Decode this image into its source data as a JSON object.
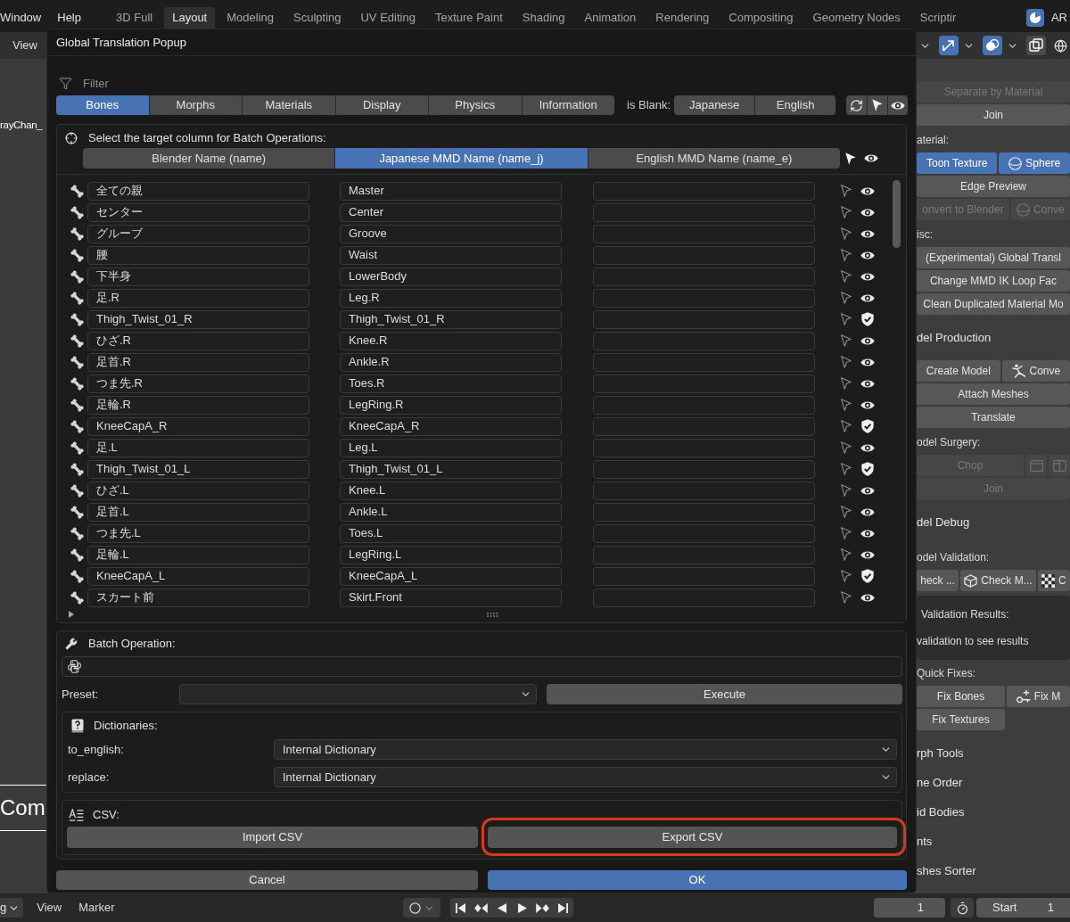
{
  "top_bar": {
    "menus": [
      "Window",
      "Help"
    ],
    "workspaces": [
      {
        "label": "3D Full",
        "selected": false
      },
      {
        "label": "Layout",
        "selected": true
      },
      {
        "label": "Modeling",
        "selected": false
      },
      {
        "label": "Sculpting",
        "selected": false
      },
      {
        "label": "UV Editing",
        "selected": false
      },
      {
        "label": "Texture Paint",
        "selected": false
      },
      {
        "label": "Shading",
        "selected": false
      },
      {
        "label": "Animation",
        "selected": false
      },
      {
        "label": "Rendering",
        "selected": false
      },
      {
        "label": "Compositing",
        "selected": false
      },
      {
        "label": "Geometry Nodes",
        "selected": false
      },
      {
        "label": "Scriptir",
        "selected": false
      }
    ],
    "scene_label": "AR"
  },
  "viewport_header": {
    "menu": "View",
    "toggles": [
      {
        "kind": "gizmo",
        "selected": true
      },
      {
        "kind": "overlay",
        "selected": true
      },
      {
        "kind": "xray",
        "selected": false
      }
    ]
  },
  "viewport": {
    "object_name": "rayChan_",
    "text_object": "Com"
  },
  "sidebar": {
    "panels": [
      {
        "items": [
          {
            "kind": "buttons",
            "buttons": [
              {
                "kind": "text",
                "label": "Separate by Material",
                "disabled": true,
                "selected": false
              }
            ]
          },
          {
            "kind": "buttons",
            "buttons": [
              {
                "kind": "text",
                "label": "Join",
                "disabled": false,
                "selected": false
              }
            ]
          },
          {
            "kind": "label",
            "text": "aterial:"
          },
          {
            "kind": "buttons",
            "buttons": [
              {
                "kind": "text",
                "label": "Toon Texture",
                "disabled": false,
                "selected": true
              },
              {
                "kind": "sphere",
                "label": "Sphere",
                "disabled": false,
                "selected": true
              }
            ]
          },
          {
            "kind": "buttons",
            "buttons": [
              {
                "kind": "text",
                "label": "Edge Preview",
                "disabled": false,
                "selected": false
              }
            ]
          },
          {
            "kind": "buttons",
            "buttons": [
              {
                "kind": "text",
                "label": "onvert to Blender",
                "disabled": true,
                "selected": false
              },
              {
                "kind": "sphere",
                "label": "Conve",
                "disabled": true,
                "selected": false
              }
            ]
          },
          {
            "kind": "label",
            "text": "isc:"
          },
          {
            "kind": "buttons",
            "buttons": [
              {
                "kind": "text",
                "label": "(Experimental) Global Transl",
                "disabled": false,
                "selected": false
              }
            ]
          },
          {
            "kind": "buttons",
            "buttons": [
              {
                "kind": "text",
                "label": "Change MMD IK Loop Fac",
                "disabled": false,
                "selected": false
              }
            ]
          },
          {
            "kind": "buttons",
            "buttons": [
              {
                "kind": "text",
                "label": "Clean Duplicated Material Mo",
                "disabled": false,
                "selected": false
              }
            ]
          }
        ]
      },
      {
        "header": "del Production",
        "items": [
          {
            "kind": "buttons",
            "buttons": [
              {
                "kind": "text",
                "label": "Create Model",
                "disabled": false,
                "selected": false
              },
              {
                "kind": "figure",
                "label": "Conve",
                "disabled": false,
                "selected": false
              }
            ]
          },
          {
            "kind": "buttons",
            "buttons": [
              {
                "kind": "text",
                "label": "Attach Meshes",
                "disabled": false,
                "selected": false
              }
            ]
          },
          {
            "kind": "buttons",
            "buttons": [
              {
                "kind": "text",
                "label": "Translate",
                "disabled": false,
                "selected": false
              }
            ]
          },
          {
            "kind": "label",
            "text": "odel Surgery:"
          },
          {
            "kind": "buttons",
            "buttons": [
              {
                "kind": "text",
                "label": "Chop",
                "disabled": true,
                "selected": false
              },
              {
                "kind": "window",
                "disabled": true,
                "selected": false
              },
              {
                "kind": "split",
                "disabled": true,
                "selected": false
              }
            ]
          },
          {
            "kind": "buttons",
            "buttons": [
              {
                "kind": "text",
                "label": "Join",
                "disabled": true,
                "selected": false
              }
            ]
          }
        ]
      },
      {
        "header": "del Debug",
        "items": [
          {
            "kind": "label",
            "text": "odel Validation:"
          },
          {
            "kind": "buttons",
            "buttons": [
              {
                "kind": "text",
                "label": "heck ...",
                "disabled": false,
                "selected": false
              },
              {
                "kind": "mesh",
                "label": "Check M...",
                "disabled": false,
                "selected": false
              },
              {
                "kind": "checker",
                "label": "C",
                "disabled": false,
                "selected": false
              }
            ]
          },
          {
            "kind": "results",
            "title": "Validation Results:",
            "message": "validation to see results"
          },
          {
            "kind": "label",
            "text": "Quick Fixes:"
          },
          {
            "kind": "grid",
            "buttons": [
              {
                "kind": "text",
                "label": "Fix Bones",
                "disabled": false,
                "selected": false
              },
              {
                "kind": "key",
                "label": "Fix M",
                "disabled": false,
                "selected": false
              }
            ]
          },
          {
            "kind": "grid",
            "buttons": [
              {
                "kind": "text",
                "label": "Fix Textures",
                "disabled": false,
                "selected": false
              }
            ]
          }
        ]
      },
      {
        "header": "rph Tools"
      },
      {
        "header": "ne Order"
      },
      {
        "header": "id Bodies"
      },
      {
        "header": "nts"
      },
      {
        "header": "shes Sorter"
      }
    ]
  },
  "popup": {
    "title": "Global Translation Popup",
    "filter": {
      "placeholder": "Filter"
    },
    "categories": [
      {
        "label": "Bones",
        "selected": true
      },
      {
        "label": "Morphs",
        "selected": false
      },
      {
        "label": "Materials",
        "selected": false
      },
      {
        "label": "Display",
        "selected": false
      },
      {
        "label": "Physics",
        "selected": false
      },
      {
        "label": "Information",
        "selected": false
      }
    ],
    "blank_filter": {
      "label": "is Blank:",
      "options": [
        {
          "label": "Japanese",
          "selected": false
        },
        {
          "label": "English",
          "selected": false
        }
      ]
    },
    "target_columns": {
      "title": "Select the target column for Batch Operations:",
      "columns": [
        {
          "label": "Blender Name (name)",
          "selected": false
        },
        {
          "label": "Japanese MMD Name (name_j)",
          "selected": true
        },
        {
          "label": "English MMD Name (name_e)",
          "selected": false
        }
      ]
    },
    "rows": [
      {
        "blender_name": "全ての親",
        "japanese_mmd_name": "Master",
        "kind": "eye"
      },
      {
        "blender_name": "センター",
        "japanese_mmd_name": "Center",
        "kind": "eye"
      },
      {
        "blender_name": "グルーブ",
        "japanese_mmd_name": "Groove",
        "kind": "eye"
      },
      {
        "blender_name": "腰",
        "japanese_mmd_name": "Waist",
        "kind": "eye"
      },
      {
        "blender_name": "下半身",
        "japanese_mmd_name": "LowerBody",
        "kind": "eye"
      },
      {
        "blender_name": "足.R",
        "japanese_mmd_name": "Leg.R",
        "kind": "eye"
      },
      {
        "blender_name": "Thigh_Twist_01_R",
        "japanese_mmd_name": "Thigh_Twist_01_R",
        "kind": "shield"
      },
      {
        "blender_name": "ひざ.R",
        "japanese_mmd_name": "Knee.R",
        "kind": "eye"
      },
      {
        "blender_name": "足首.R",
        "japanese_mmd_name": "Ankle.R",
        "kind": "eye"
      },
      {
        "blender_name": "つま先.R",
        "japanese_mmd_name": "Toes.R",
        "kind": "eye"
      },
      {
        "blender_name": "足輪.R",
        "japanese_mmd_name": "LegRing.R",
        "kind": "eye"
      },
      {
        "blender_name": "KneeCapA_R",
        "japanese_mmd_name": "KneeCapA_R",
        "kind": "shield"
      },
      {
        "blender_name": "足.L",
        "japanese_mmd_name": "Leg.L",
        "kind": "eye"
      },
      {
        "blender_name": "Thigh_Twist_01_L",
        "japanese_mmd_name": "Thigh_Twist_01_L",
        "kind": "shield"
      },
      {
        "blender_name": "ひざ.L",
        "japanese_mmd_name": "Knee.L",
        "kind": "eye"
      },
      {
        "blender_name": "足首.L",
        "japanese_mmd_name": "Ankle.L",
        "kind": "eye"
      },
      {
        "blender_name": "つま先.L",
        "japanese_mmd_name": "Toes.L",
        "kind": "eye"
      },
      {
        "blender_name": "足輪.L",
        "japanese_mmd_name": "LegRing.L",
        "kind": "eye"
      },
      {
        "blender_name": "KneeCapA_L",
        "japanese_mmd_name": "KneeCapA_L",
        "kind": "shield"
      },
      {
        "blender_name": "スカート前",
        "japanese_mmd_name": "Skirt.Front",
        "kind": "eye"
      }
    ],
    "batch": {
      "title": "Batch Operation:",
      "preset_label": "Preset:",
      "execute_label": "Execute",
      "dictionaries": {
        "title": "Dictionaries:",
        "rows": [
          {
            "label": "to_english:",
            "value": "Internal Dictionary"
          },
          {
            "label": "replace:",
            "value": "Internal Dictionary"
          }
        ]
      },
      "csv": {
        "title": "CSV:",
        "buttons": [
          {
            "label": "Import CSV",
            "highlighted": false
          },
          {
            "label": "Export CSV",
            "highlighted": true
          }
        ]
      }
    },
    "actions": [
      {
        "label": "Cancel",
        "default": false
      },
      {
        "label": "OK",
        "default": true
      }
    ]
  },
  "timeline": {
    "mode": "g",
    "menus": [
      "View",
      "Marker"
    ],
    "current_frame": "1",
    "start": {
      "label": "Start",
      "value": "1"
    }
  }
}
